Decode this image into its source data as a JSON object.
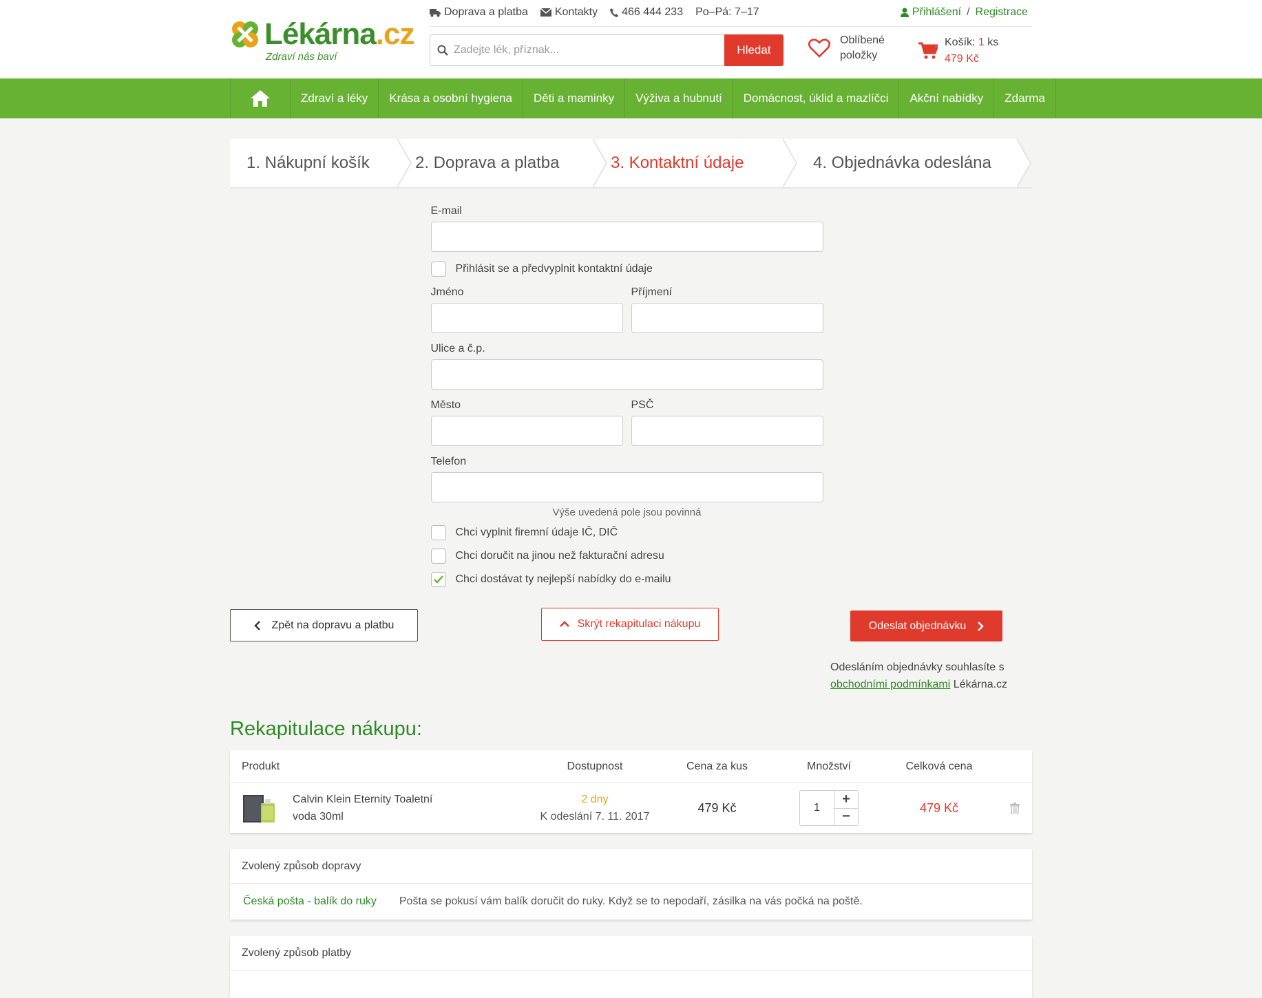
{
  "brand": {
    "name": "Lékárna",
    "tld": ".cz",
    "tagline": "Zdraví nás baví"
  },
  "toplinks": {
    "shipping": "Doprava a platba",
    "contacts": "Kontakty",
    "phone": "466 444 233",
    "hours": "Po–Pá: 7–17"
  },
  "auth": {
    "login": "Přihlášení",
    "separator": "/",
    "register": "Registrace"
  },
  "search": {
    "placeholder": "Zadejte lék, příznak...",
    "button": "Hledat"
  },
  "favorites": {
    "line1": "Oblíbené",
    "line2": "položky"
  },
  "cart": {
    "label": "Košík:",
    "count": "1",
    "unit": "ks",
    "total": "479 Kč"
  },
  "nav": {
    "items": [
      "Zdraví a léky",
      "Krása a osobní hygiena",
      "Děti a maminky",
      "Výživa a hubnutí",
      "Domácnost, úklid a mazlíčci",
      "Akční nabídky",
      "Zdarma"
    ]
  },
  "steps": [
    {
      "label": "1. Nákupní košík",
      "state": "done"
    },
    {
      "label": "2. Doprava a platba",
      "state": "done"
    },
    {
      "label": "3. Kontaktní údaje",
      "state": "active"
    },
    {
      "label": "4. Objednávka odeslána",
      "state": "todo"
    }
  ],
  "form": {
    "email_label": "E-mail",
    "login_prefill": "Přihlásit se a předvyplnit kontaktní údaje",
    "first_name": "Jméno",
    "last_name": "Příjmení",
    "street": "Ulice a č.p.",
    "city": "Město",
    "zip": "PSČ",
    "phone": "Telefon",
    "required_note": "Výše uvedená pole jsou povinná",
    "company_option": "Chci vyplnit firemní údaje IČ, DIČ",
    "alt_address_option": "Chci doručit na jinou než fakturační adresu",
    "newsletter_option": "Chci dostávat ty nejlepší nabídky do e-mailu",
    "newsletter_checked": true
  },
  "actions": {
    "back": "Zpět na dopravu a platbu",
    "hide_recap": "Skrýt rekapitulaci nákupu",
    "submit": "Odeslat objednávku",
    "terms_prefix": "Odesláním objednávky souhlasíte s",
    "terms_link": "obchodními podmínkami",
    "terms_suffix": "Lékárna.cz"
  },
  "recap": {
    "title": "Rekapitulace nákupu:",
    "columns": {
      "product": "Produkt",
      "availability": "Dostupnost",
      "unit_price": "Cena za kus",
      "quantity": "Množství",
      "total": "Celková cena"
    },
    "items": [
      {
        "name": "Calvin Klein Eternity Toaletní voda 30ml",
        "availability": "2 dny",
        "ship_date": "K odeslání 7. 11. 2017",
        "unit_price": "479 Kč",
        "quantity": "1",
        "total": "479 Kč"
      }
    ]
  },
  "shipping": {
    "title": "Zvolený způsob dopravy",
    "name": "Česká pošta - balík do ruky",
    "description": "Pošta se pokusí vám balík doručit do ruky. Když se to nepodaří, zásilka na vás počká na poště."
  },
  "payment": {
    "title": "Zvolený způsob platby"
  },
  "colors": {
    "green": "#67b233",
    "dark_green": "#2e8b24",
    "red": "#e03a2c",
    "orange": "#e8a317"
  }
}
